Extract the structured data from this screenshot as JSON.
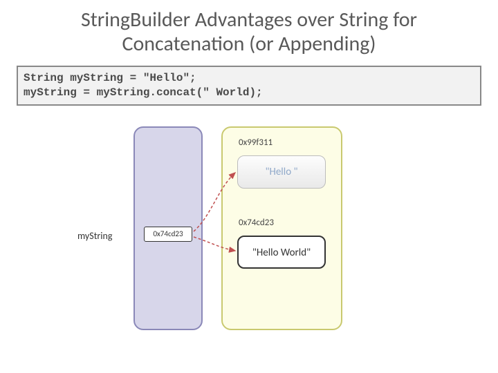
{
  "title": "StringBuilder Advantages over String for Concatenation (or Appending)",
  "code": "String myString = \"Hello\";\nmyString = myString.concat(\" World);",
  "variable_label": "myString",
  "pointer_value": "0x74cd23",
  "heap": {
    "addr_old": "0x99f311",
    "obj_old": "\"Hello \"",
    "addr_new": "0x74cd23",
    "obj_new": "\"Hello World\""
  }
}
